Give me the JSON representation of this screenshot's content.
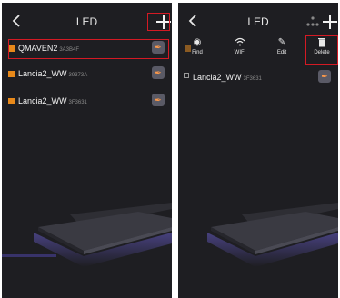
{
  "left": {
    "title": "LED",
    "devices": [
      {
        "name": "QMAVEN2",
        "id": "3A3B4F"
      },
      {
        "name": "Lancia2_WW",
        "id": "39373A"
      },
      {
        "name": "Lancia2_WW",
        "id": "3F3631"
      }
    ]
  },
  "right": {
    "title": "LED",
    "actions": [
      {
        "label": "Find",
        "icon": "eye-icon"
      },
      {
        "label": "WIFI",
        "icon": "wifi-icon"
      },
      {
        "label": "Edit",
        "icon": "edit-icon"
      },
      {
        "label": "Delete",
        "icon": "trash-icon"
      }
    ],
    "devices": [
      {
        "name": "Lancia2_WW",
        "id": "3F3631"
      }
    ]
  },
  "colors": {
    "background": "#1e1e22",
    "accent": "#e8891a",
    "highlight": "#d41a24"
  }
}
